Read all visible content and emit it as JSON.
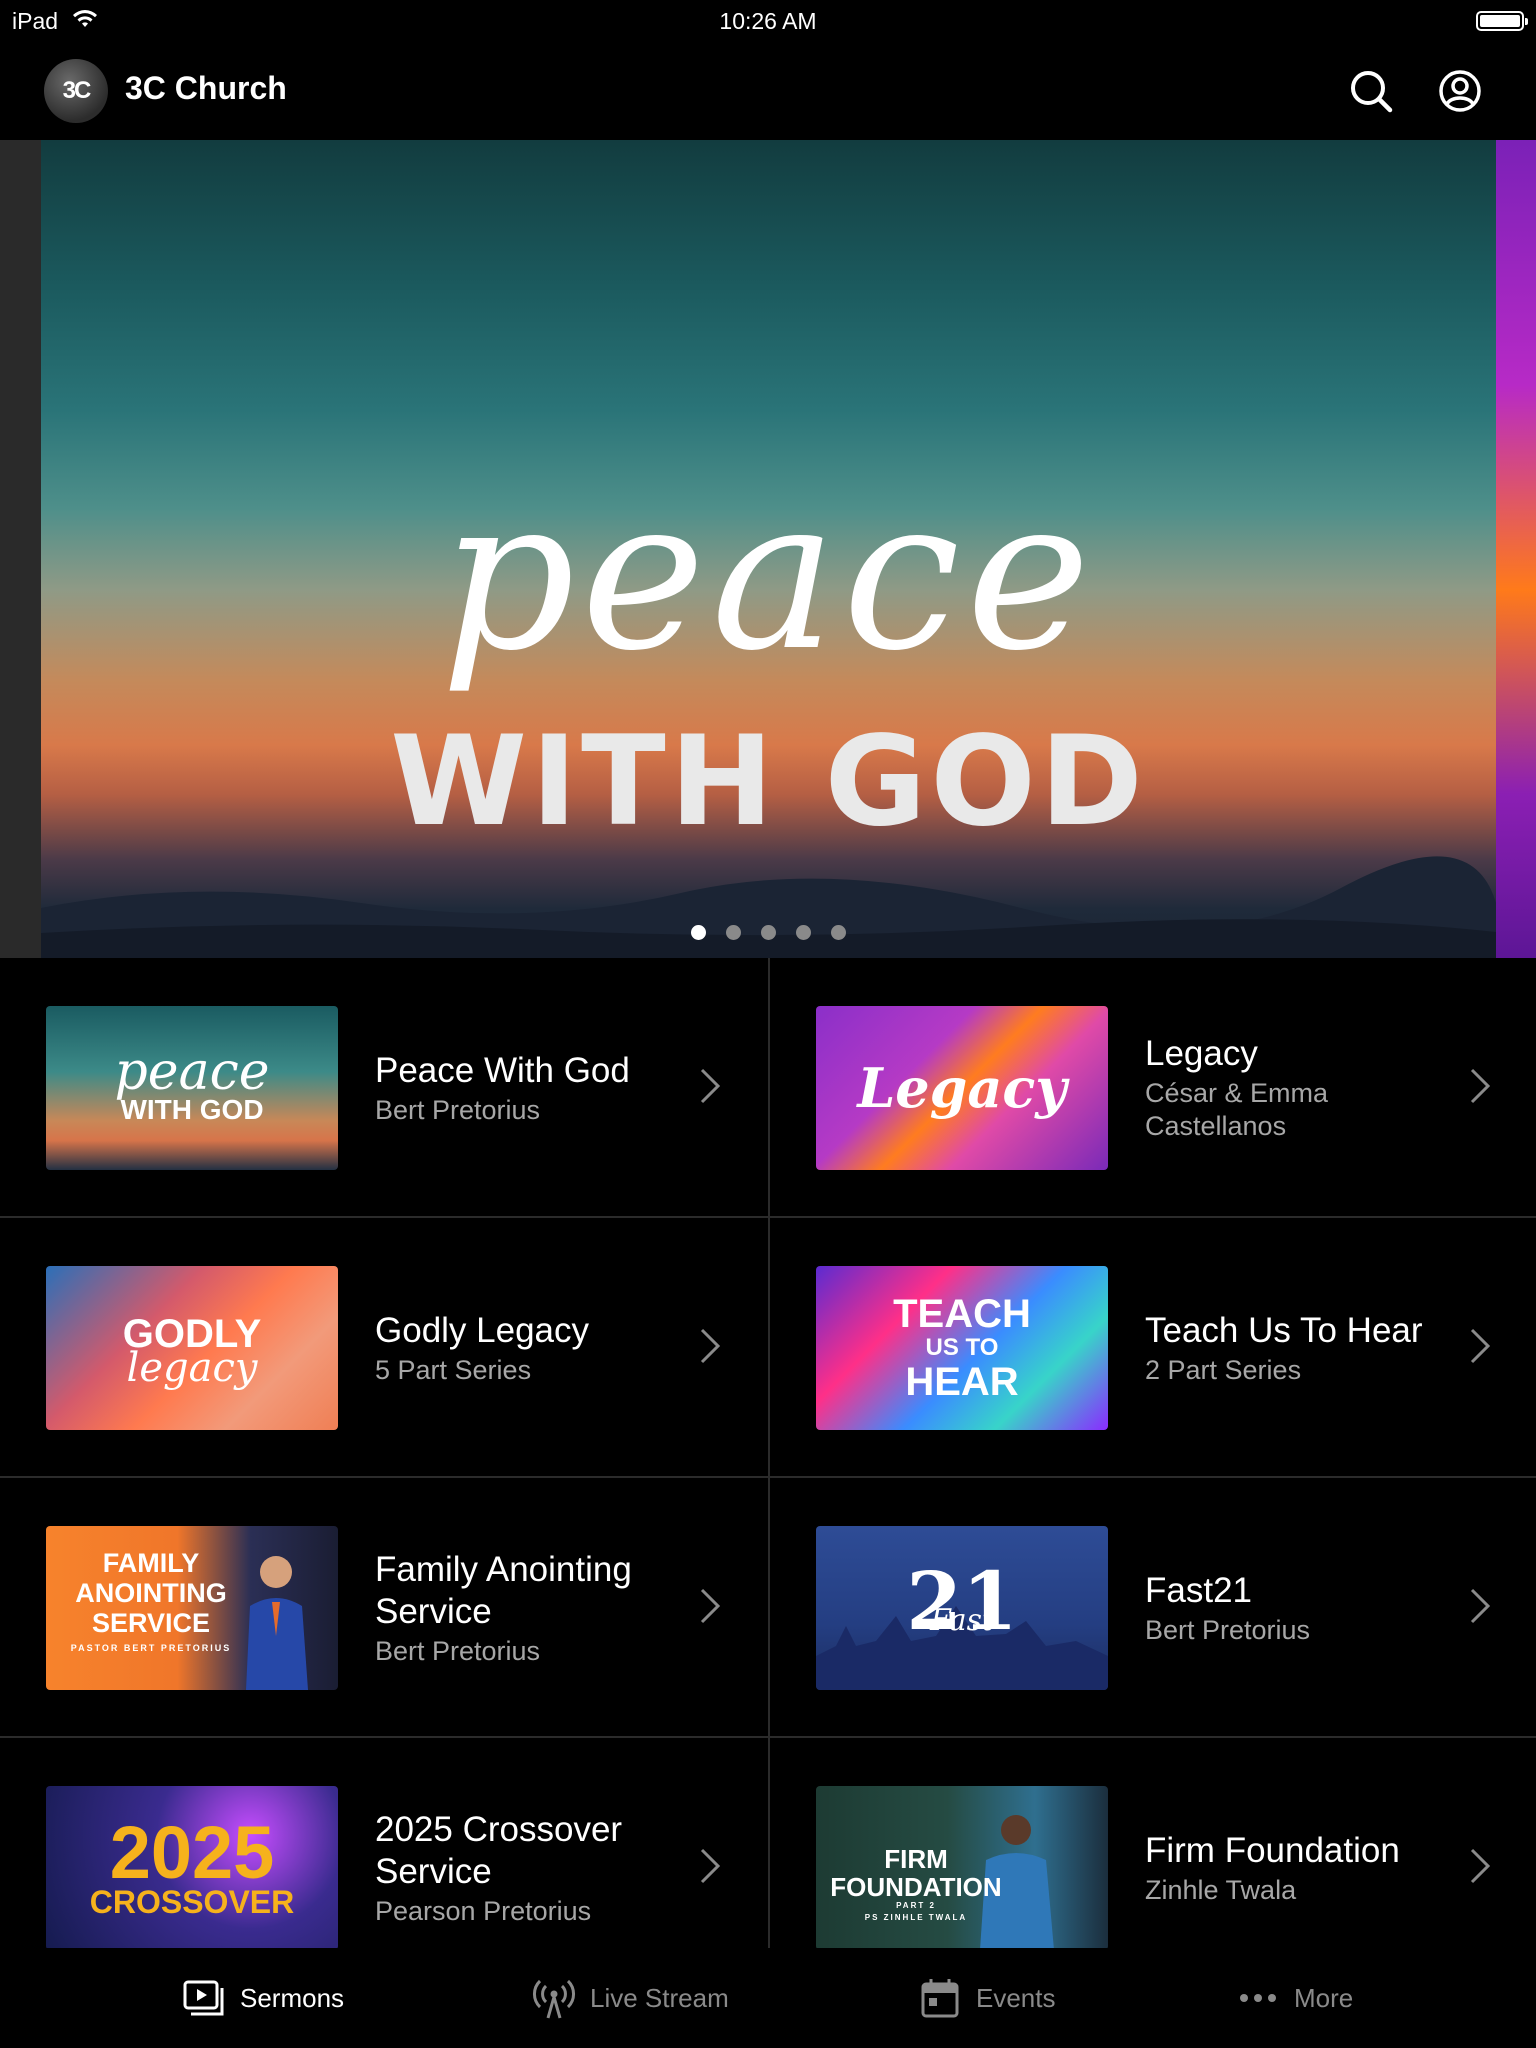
{
  "status_bar": {
    "device": "iPad",
    "time": "10:26 AM"
  },
  "header": {
    "logo_text": "3C",
    "title": "3C Church"
  },
  "hero": {
    "script_text": "peace",
    "bold_text": "WITH GOD",
    "slide_count": 5,
    "active_slide": 1
  },
  "sermons": [
    {
      "title": "Peace With God",
      "subtitle": "Bert Pretorius",
      "thumb_line1": "peace",
      "thumb_line2": "WITH GOD"
    },
    {
      "title": "Legacy",
      "subtitle": "César & Emma Castellanos",
      "thumb_line1": "Legacy",
      "thumb_line2": ""
    },
    {
      "title": "Godly Legacy",
      "subtitle": "5 Part Series",
      "thumb_line1": "GODLY",
      "thumb_line2": "legacy"
    },
    {
      "title": "Teach Us To Hear",
      "subtitle": "2 Part Series",
      "thumb_line1": "TEACH",
      "thumb_line2": "US TO",
      "thumb_line3": "HEAR"
    },
    {
      "title": "Family Anointing Service",
      "subtitle": "Bert Pretorius",
      "thumb_line1": "FAMILY",
      "thumb_line2": "ANOINTING",
      "thumb_line3": "SERVICE",
      "thumb_line4": "PASTOR BERT PRETORIUS"
    },
    {
      "title": "Fast21",
      "subtitle": "Bert Pretorius",
      "thumb_line1": "21",
      "thumb_line2": "Fast"
    },
    {
      "title": "2025 Crossover Service",
      "subtitle": "Pearson Pretorius",
      "thumb_line1": "2025",
      "thumb_line2": "CROSSOVER"
    },
    {
      "title": "Firm Foundation",
      "subtitle": "Zinhle Twala",
      "thumb_line1": "FIRM",
      "thumb_line2": "FOUNDATION",
      "thumb_line3": "PART 2",
      "thumb_line4": "PS ZINHLE TWALA"
    }
  ],
  "tabs": [
    {
      "label": "Sermons",
      "icon": "sermons-icon",
      "active": true
    },
    {
      "label": "Live Stream",
      "icon": "live-stream-icon",
      "active": false
    },
    {
      "label": "Events",
      "icon": "calendar-icon",
      "active": false
    },
    {
      "label": "More",
      "icon": "more-dots-icon",
      "active": false
    }
  ],
  "colors": {
    "background": "#000000",
    "divider": "#2b2b2b",
    "subtitle": "#a7a7a7",
    "inactive_tab": "#8a8a8a"
  }
}
